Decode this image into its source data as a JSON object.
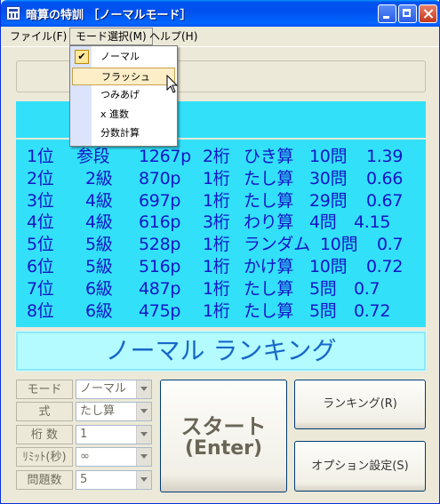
{
  "window": {
    "title": "暗算の特訓 ［ノーマルモード］"
  },
  "menubar": {
    "file": "ファイル(F)",
    "mode": "モード選択(M)",
    "help": "ヘルプ(H)"
  },
  "mode_menu": {
    "items": [
      "ノーマル",
      "フラッシュ",
      "つみあげ",
      "x 進数",
      "分数計算"
    ],
    "checked": "ノーマル",
    "highlighted": "フラッシュ"
  },
  "ranking": {
    "rows": [
      {
        "rank": "1位",
        "grade": "参段",
        "points": "1267p",
        "digits": "2桁",
        "op": "ひき算",
        "questions": "10問",
        "time": "1.39"
      },
      {
        "rank": "2位",
        "grade": "2級",
        "points": "870p",
        "digits": "1桁",
        "op": "たし算",
        "questions": "30問",
        "time": "0.66"
      },
      {
        "rank": "3位",
        "grade": "4級",
        "points": "697p",
        "digits": "1桁",
        "op": "たし算",
        "questions": "29問",
        "time": "0.67"
      },
      {
        "rank": "4位",
        "grade": "4級",
        "points": "616p",
        "digits": "3桁",
        "op": "わり算",
        "questions": "4問",
        "time": "4.15"
      },
      {
        "rank": "5位",
        "grade": "5級",
        "points": "528p",
        "digits": "1桁",
        "op": "ランダム",
        "questions": "10問",
        "time": "0.7"
      },
      {
        "rank": "6位",
        "grade": "5級",
        "points": "516p",
        "digits": "1桁",
        "op": "かけ算",
        "questions": "10問",
        "time": "0.72"
      },
      {
        "rank": "7位",
        "grade": "6級",
        "points": "487p",
        "digits": "1桁",
        "op": "たし算",
        "questions": "5問",
        "time": "0.7"
      },
      {
        "rank": "8位",
        "grade": "6級",
        "points": "475p",
        "digits": "1桁",
        "op": "たし算",
        "questions": "5問",
        "time": "0.72"
      }
    ]
  },
  "ranking_title": "ノーマル ランキング",
  "settings": {
    "mode": {
      "label": "モード",
      "value": "ノーマル"
    },
    "formula": {
      "label": "式",
      "value": "たし算"
    },
    "digits": {
      "label": "桁 数",
      "value": "1"
    },
    "limit": {
      "label": "ﾘﾐｯﾄ(秒)",
      "value": "∞"
    },
    "questions": {
      "label": "問題数",
      "value": "5"
    }
  },
  "buttons": {
    "start_line1": "スタート",
    "start_line2": "(Enter)",
    "ranking": "ランキング(R)",
    "options": "オプション設定(S)"
  },
  "colors": {
    "panel": "#32e1f9",
    "ranking_text": "#1414c8",
    "title_text": "#1669c8"
  }
}
